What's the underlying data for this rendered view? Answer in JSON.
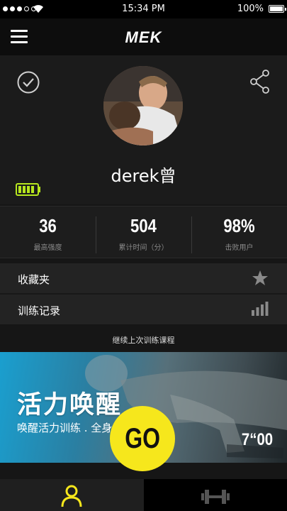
{
  "status_bar": {
    "time": "15:34 PM",
    "battery": "100%"
  },
  "nav": {
    "logo": "MEK"
  },
  "profile": {
    "username": "derek曾"
  },
  "stats": [
    {
      "value": "36",
      "label": "最高强度"
    },
    {
      "value": "504",
      "label": "累计时间（分）"
    },
    {
      "value": "98%",
      "label": "击败用户"
    }
  ],
  "menu": {
    "favorites": "收藏夹",
    "history": "训练记录"
  },
  "resume": {
    "label": "继续上次训练课程"
  },
  "banner": {
    "title": "活力唤醒",
    "subtitle": "唤醒活力训练 . 全身",
    "duration": "7“00",
    "go_label": "GO"
  },
  "colors": {
    "accent": "#f6e71c",
    "battery_green": "#b6e61e",
    "banner_blue": "#1a9fcf"
  },
  "icons": [
    "menu-icon",
    "check-icon",
    "share-icon",
    "battery-icon",
    "star-icon",
    "bars-icon",
    "user-icon",
    "dumbbell-icon"
  ]
}
